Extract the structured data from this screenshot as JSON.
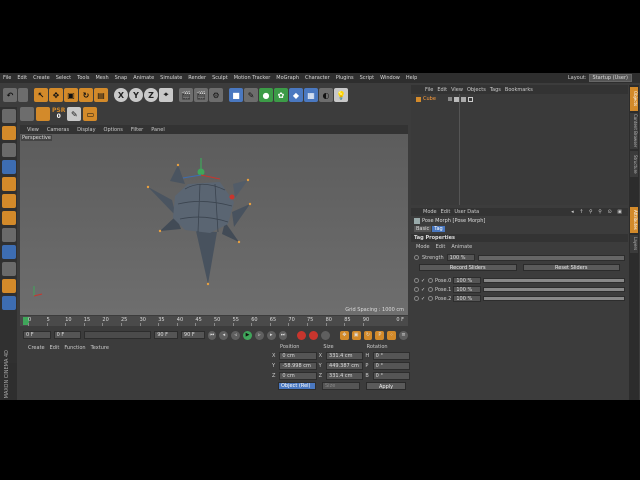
{
  "menubar": {
    "items": [
      "File",
      "Edit",
      "Create",
      "Select",
      "Tools",
      "Mesh",
      "Snap",
      "Animate",
      "Simulate",
      "Render",
      "Sculpt",
      "Motion Tracker",
      "MoGraph",
      "Character",
      "Plugins",
      "Script",
      "Window",
      "Help"
    ]
  },
  "layout": {
    "label": "Layout:",
    "value": "Startup (User)"
  },
  "psr": {
    "label": "PSR",
    "value": "0"
  },
  "viewport": {
    "menu": [
      "View",
      "Cameras",
      "Display",
      "Options",
      "Filter",
      "Panel"
    ],
    "label": "Perspective",
    "grid_spacing": "Grid Spacing : 1000 cm"
  },
  "timeline": {
    "ticks": [
      "0",
      "5",
      "10",
      "15",
      "20",
      "25",
      "30",
      "35",
      "40",
      "45",
      "50",
      "55",
      "60",
      "65",
      "70",
      "75",
      "80",
      "85",
      "90"
    ],
    "end_label": "0 F"
  },
  "transport": {
    "current": "0 F",
    "start": "0 F",
    "end": "90 F",
    "end2": "90 F"
  },
  "material": {
    "menu": [
      "Create",
      "Edit",
      "Function",
      "Texture"
    ]
  },
  "coords": {
    "headers": [
      "Position",
      "Size",
      "Rotation"
    ],
    "rows": [
      {
        "a1": "X",
        "v1": "0 cm",
        "a2": "X",
        "v2": "331.4 cm",
        "a3": "H",
        "v3": "0 °"
      },
      {
        "a1": "Y",
        "v1": "-58.998 cm",
        "a2": "Y",
        "v2": "449.387 cm",
        "a3": "P",
        "v3": "0 °"
      },
      {
        "a1": "Z",
        "v1": "0 cm",
        "a2": "Z",
        "v2": "331.4 cm",
        "a3": "B",
        "v3": "0 °"
      }
    ],
    "mode": "Object (Rel)",
    "size_mode": "Size",
    "apply": "Apply"
  },
  "brand": "MAXON CINEMA 4D",
  "objects": {
    "menu": [
      "File",
      "Edit",
      "View",
      "Objects",
      "Tags",
      "Bookmarks"
    ],
    "items": [
      {
        "name": "Cube"
      }
    ]
  },
  "attributes": {
    "menu": [
      "Mode",
      "Edit",
      "User Data"
    ],
    "title": "Pose Morph [Pose Morph]",
    "tabs": [
      "Basic",
      "Tag"
    ],
    "section": "Tag Properties",
    "modes": [
      "Mode",
      "Edit",
      "Animate"
    ],
    "strength_label": "Strength",
    "strength_value": "100 %",
    "record": "Record Sliders",
    "reset": "Reset Sliders",
    "poses": [
      {
        "name": "Pose.0",
        "value": "100 %"
      },
      {
        "name": "Pose.1",
        "value": "100 %"
      },
      {
        "name": "Pose.2",
        "value": "100 %"
      }
    ]
  },
  "right_tabs": [
    "Objects",
    "Content Browser",
    "Structure",
    "Attributes",
    "Layers"
  ],
  "colors": {
    "accent": "#d38a2a",
    "selection": "#4a78c0",
    "play": "#3fa65a"
  }
}
